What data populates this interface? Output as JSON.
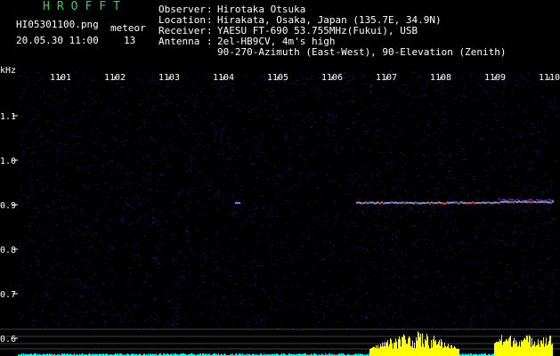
{
  "station": {
    "brand": "HROFFT",
    "filename": "HI05301100.png",
    "timestamp": "20.05.30 11:00",
    "meteor_label": "meteor",
    "meteor_count": "13"
  },
  "info": {
    "observer_label": "Observer",
    "observer": "Hirotaka Otsuka",
    "location_label": "Location",
    "location": "Hirakata, Osaka, Japan (135.7E, 34.9N)",
    "receiver_label": "Receiver",
    "receiver": "YAESU FT-690 53.755MHz(Fukui), USB",
    "antenna_label": "Antenna",
    "antenna": "2el-HB9CV, 4m's high",
    "antenna2": "90-270-Azimuth (East-West), 90-Elevation (Zenith)",
    "sep": ":"
  },
  "axis": {
    "y_unit": "kHz",
    "x_ticks": [
      "1101",
      "1102",
      "1103",
      "1104",
      "1105",
      "1106",
      "1107",
      "1108",
      "1109",
      "1110"
    ],
    "y_ticks": [
      "1.1",
      "1.0",
      "0.9",
      "0.8",
      "0.7",
      "0.6"
    ]
  },
  "colors": {
    "background": "#000000",
    "noise": "#1a1a6e",
    "signal": "#ff2020",
    "histogram": "#ffff00",
    "histogram_low": "#00ffff",
    "grid": "#808080"
  }
}
